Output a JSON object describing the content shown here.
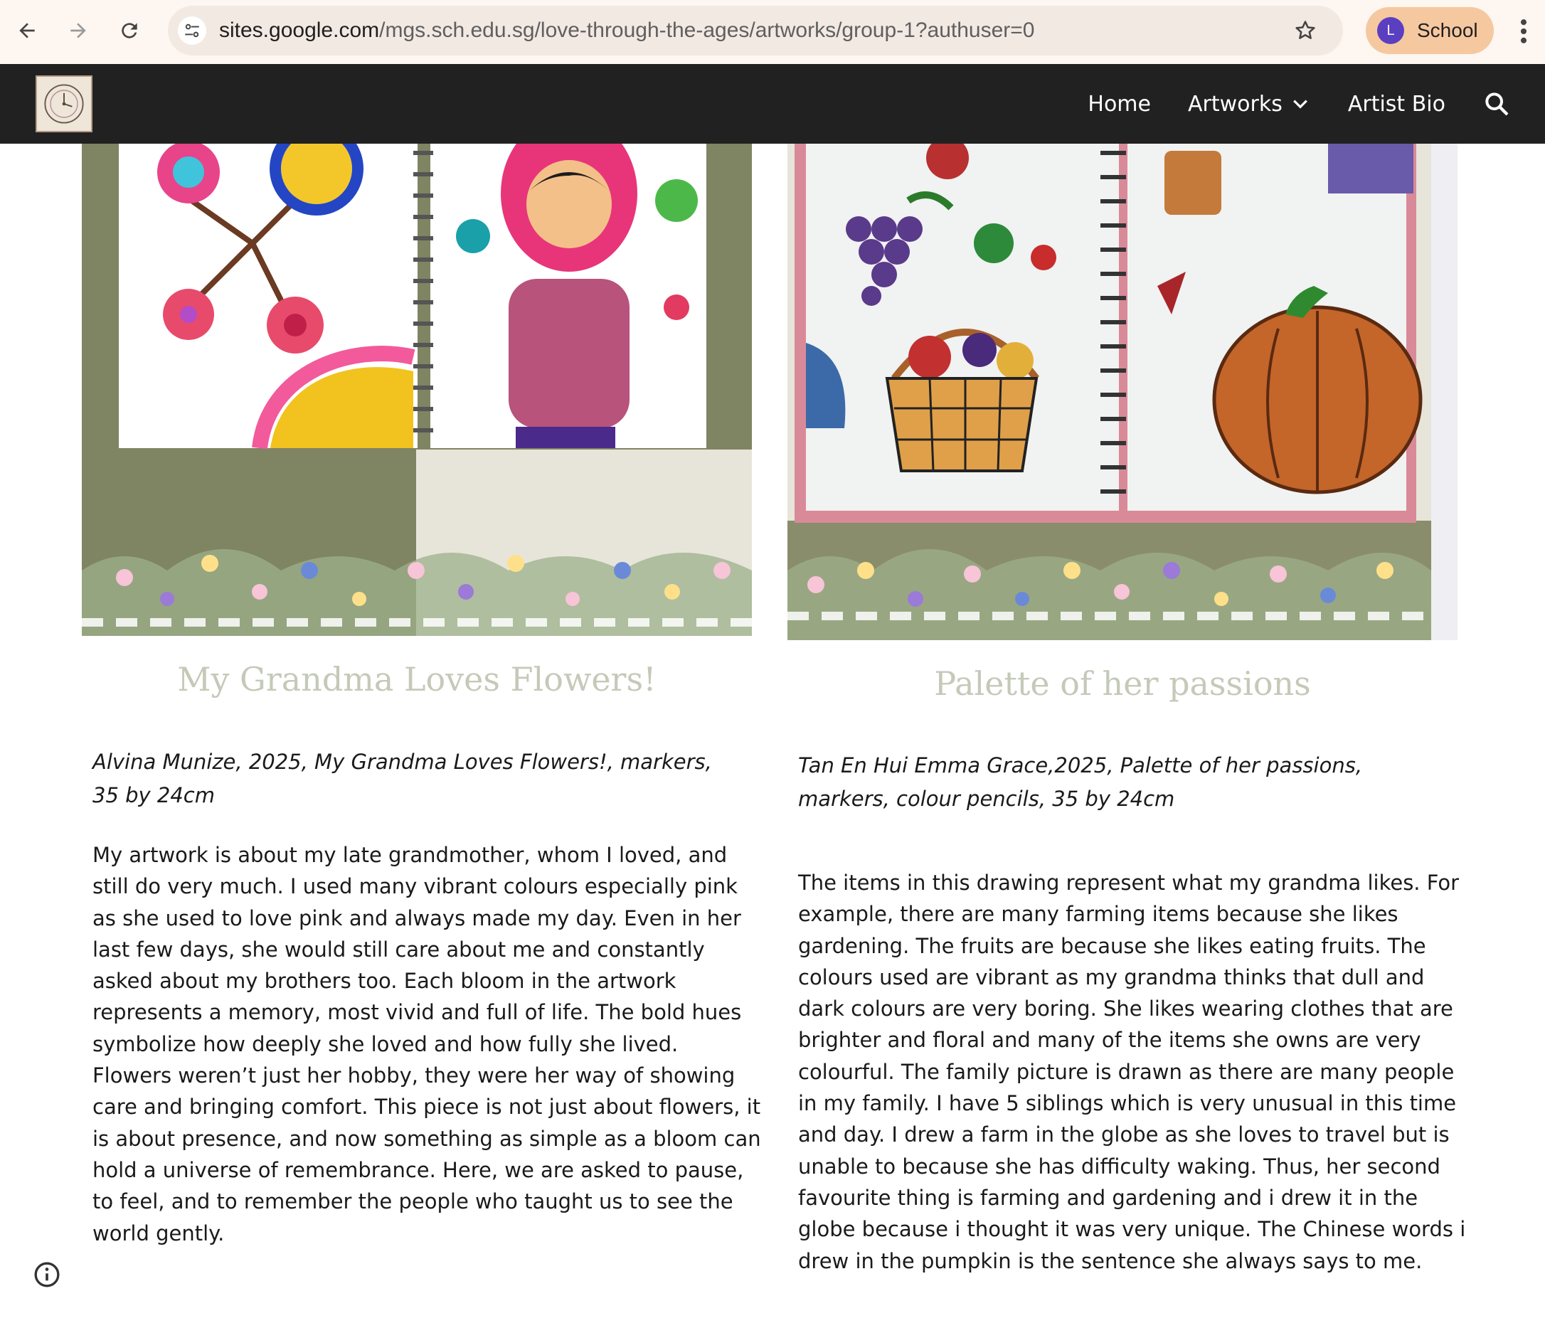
{
  "browser": {
    "url_host": "sites.google.com",
    "url_path": "/mgs.sch.edu.sg/love-through-the-ages/artworks/group-1?authuser=0",
    "profile_initial": "L",
    "profile_label": "School"
  },
  "site": {
    "nav": {
      "home": "Home",
      "artworks": "Artworks",
      "artist_bio": "Artist Bio"
    }
  },
  "artworks": [
    {
      "title": "My Grandma Loves Flowers!",
      "caption": "Alvina Munize, 2025, My Grandma Loves Flowers!, markers, 35 by 24cm",
      "description": "My artwork is about my late grandmother, whom I loved, and still do very much. I used many vibrant colours especially pink as she used to love pink and always made my day. Even in her last few days, she would still care about me and constantly asked about my brothers too. Each bloom in the artwork represents a memory, most vivid and full of life. The bold hues symbolize how deeply she loved and how fully she lived. Flowers weren’t just her hobby, they were her way of showing care and bringing comfort. This piece is not just  about flowers, it is about presence, and now something as simple as a bloom can hold a universe of remembrance. Here, we are asked to pause, to feel, and to remember the people who taught us to see the world gently."
    },
    {
      "title": "Palette of her passions",
      "caption": "Tan En Hui Emma Grace,2025, Palette of her passions, markers, colour pencils, 35 by 24cm",
      "description": "The items in this drawing represent what my grandma likes. For example, there are many farming items because she likes gardening. The fruits are because she likes eating fruits. The colours used are vibrant as my grandma thinks that dull and dark colours are very boring. She likes wearing clothes that are brighter and floral and many of the items she owns are very colourful. The family picture is drawn as there are many people in my family. I have 5 siblings which is very unusual in this time and day. I drew a farm in the globe as she loves to travel but is unable to because she has difficulty waking. Thus, her second favourite thing is farming and gardening and i drew it in the globe because i thought it was very unique. The Chinese words i drew in the pumpkin is the sentence she always says to me."
    }
  ],
  "colors": {
    "header_bg": "#212121",
    "title_color": "#c5c9b8",
    "chrome_bg": "#fdf6f1",
    "profile_chip": "#f6c8a0"
  }
}
